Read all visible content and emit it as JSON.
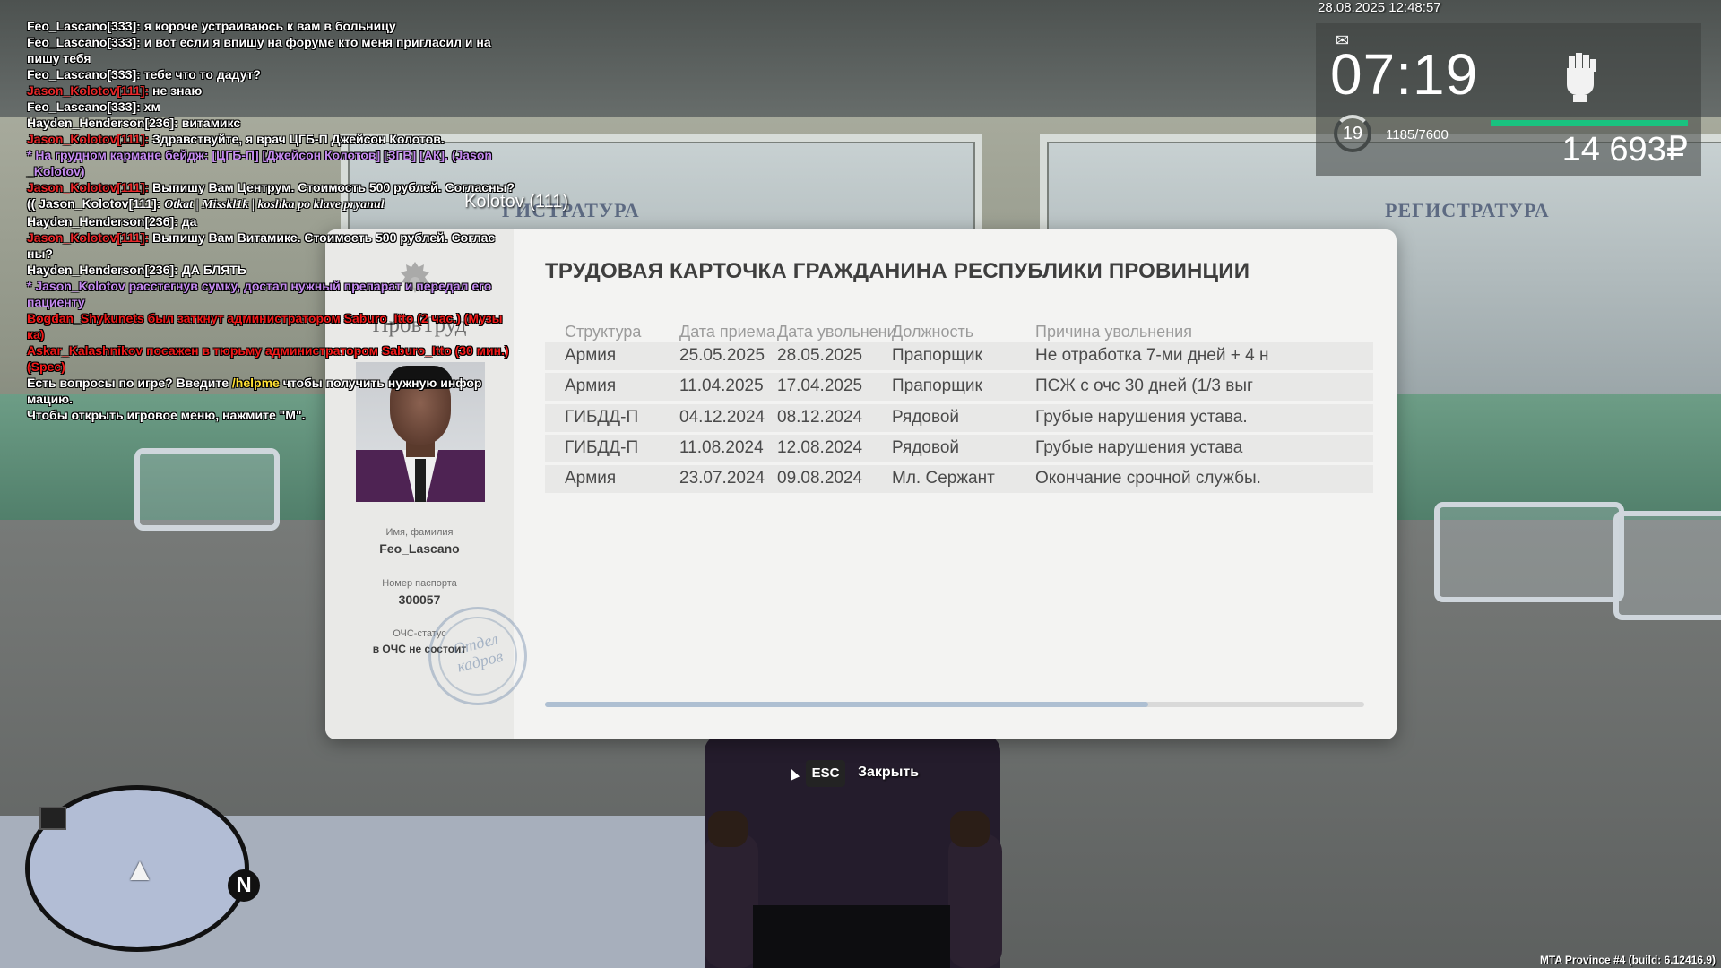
{
  "chat": [
    {
      "segs": [
        {
          "t": "Feo_Lascano[333]: я короче устраиваюсь к вам в больницу",
          "c": "white"
        }
      ]
    },
    {
      "segs": [
        {
          "t": "Feo_Lascano[333]: и  вот если я впишу на форуме кто меня пригласил и на",
          "c": "white"
        }
      ]
    },
    {
      "segs": [
        {
          "t": "пишу тебя",
          "c": "white"
        }
      ]
    },
    {
      "segs": [
        {
          "t": "Feo_Lascano[333]: тебе что то дадут?",
          "c": "white"
        }
      ]
    },
    {
      "segs": [
        {
          "t": "Jason_Kolotov[111]:",
          "c": "name-red"
        },
        {
          "t": " не знаю",
          "c": "white"
        }
      ]
    },
    {
      "segs": [
        {
          "t": "Feo_Lascano[333]: хм",
          "c": "white"
        }
      ]
    },
    {
      "segs": [
        {
          "t": "Hayden_Henderson[236]: витамикс",
          "c": "white"
        }
      ]
    },
    {
      "segs": [
        {
          "t": "Jason_Kolotov[111]:",
          "c": "name-red"
        },
        {
          "t": " Здравствуйте, я врач ЦГБ-П Джейсон Колотов.",
          "c": "white"
        }
      ]
    },
    {
      "segs": [
        {
          "t": "* На грудном кармане бейдж: [ЦГБ-П] [Джейсон Колотов] [ЗГВ] [АК]. (Jason",
          "c": "purple"
        }
      ]
    },
    {
      "segs": [
        {
          "t": "_Kolotov)",
          "c": "purple"
        }
      ]
    },
    {
      "segs": [
        {
          "t": "Jason_Kolotov[111]:",
          "c": "name-red"
        },
        {
          "t": " Выпишу Вам Центрум. Стоимость 500 рублей. Согласны?",
          "c": "white"
        }
      ]
    },
    {
      "segs": [
        {
          "t": "(( Jason_Kolotov[111]: ",
          "c": "white"
        },
        {
          "t": "Otkat | Misskl1k | koshka po klave pryanul",
          "c": "white-italic"
        }
      ]
    },
    {
      "segs": [
        {
          "t": "Hayden_Henderson[236]: да",
          "c": "white"
        }
      ]
    },
    {
      "segs": [
        {
          "t": "Jason_Kolotov[111]:",
          "c": "name-red"
        },
        {
          "t": " Выпишу Вам Витамикс. Стоимость 500 рублей. Соглас",
          "c": "white"
        }
      ]
    },
    {
      "segs": [
        {
          "t": "ны?",
          "c": "white"
        }
      ]
    },
    {
      "segs": [
        {
          "t": "Hayden_Henderson[236]: ДА БЛЯТЬ",
          "c": "white"
        }
      ]
    },
    {
      "segs": [
        {
          "t": "* Jason_Kolotov расстегнув сумку, достал нужный препарат и передал его",
          "c": "purple"
        }
      ]
    },
    {
      "segs": [
        {
          "t": "пациенту",
          "c": "purple"
        }
      ]
    },
    {
      "segs": [
        {
          "t": "Bogdan_Shykunets был заткнут администратором Saburo_Itto (2 час.) (Музы",
          "c": "red"
        }
      ]
    },
    {
      "segs": [
        {
          "t": "ка)",
          "c": "red"
        }
      ]
    },
    {
      "segs": [
        {
          "t": "Askar_Kalashnikov посажен в тюрьму администратором Saburo_Itto (30 мин.)",
          "c": "red"
        }
      ]
    },
    {
      "segs": [
        {
          "t": "(Spec)",
          "c": "red"
        }
      ]
    },
    {
      "segs": [
        {
          "t": "Есть вопросы по игре? Введите ",
          "c": "white"
        },
        {
          "t": "/helpme",
          "c": "yellow"
        },
        {
          "t": " чтобы получить нужную инфор",
          "c": "white"
        }
      ]
    },
    {
      "segs": [
        {
          "t": "мацию.",
          "c": "white"
        }
      ]
    },
    {
      "segs": [
        {
          "t": "Чтобы открыть игровое меню, нажмите \"M\".",
          "c": "white"
        }
      ]
    }
  ],
  "hud": {
    "date": "28.08.2025 12:48:57",
    "time": "07:19",
    "level": "19",
    "xp": "1185/7600",
    "xp_fraction": 0.156,
    "money": "14 693₽",
    "icons": [
      "mail-icon",
      "fist-icon"
    ]
  },
  "nametag": "Kolotov (111)",
  "card": {
    "brand": "ПровТруд",
    "title": "ТРУДОВАЯ КАРТОЧКА ГРАЖДАНИНА РЕСПУБЛИКИ ПРОВИНЦИИ",
    "name_label": "Имя, фамилия",
    "name_value": "Feo_Lascano",
    "passport_label": "Номер паспорта",
    "passport_value": "300057",
    "status_label": "ОЧС-статус",
    "status_value": "в ОЧС не состоит",
    "stamp_text": "Отдел кадров",
    "columns": [
      "Структура",
      "Дата приема",
      "Дата увольнени",
      "Должность",
      "Причина увольнения"
    ],
    "rows": [
      [
        "Армия",
        "25.05.2025",
        "28.05.2025",
        "Прапорщик",
        "Не отработка 7-ми дней + 4 н"
      ],
      [
        "Армия",
        "11.04.2025",
        "17.04.2025",
        "Прапорщик",
        "ПСЖ с очс 30 дней (1/3 выг"
      ],
      [
        "ГИБДД-П",
        "04.12.2024",
        "08.12.2024",
        "Рядовой",
        "Грубые нарушения устава."
      ],
      [
        "ГИБДД-П",
        "11.08.2024",
        "12.08.2024",
        "Рядовой",
        "Грубые нарушения устава"
      ],
      [
        "Армия",
        "23.07.2024",
        "09.08.2024",
        "Мл. Сержант",
        "Окончание срочной службы."
      ]
    ],
    "scroll_fraction": 0.736
  },
  "close_hint": {
    "key": "ESC",
    "label": "Закрыть"
  },
  "minimap": {
    "north": "N"
  },
  "build": "MTA Province #4 (build: 6.12416.9)"
}
